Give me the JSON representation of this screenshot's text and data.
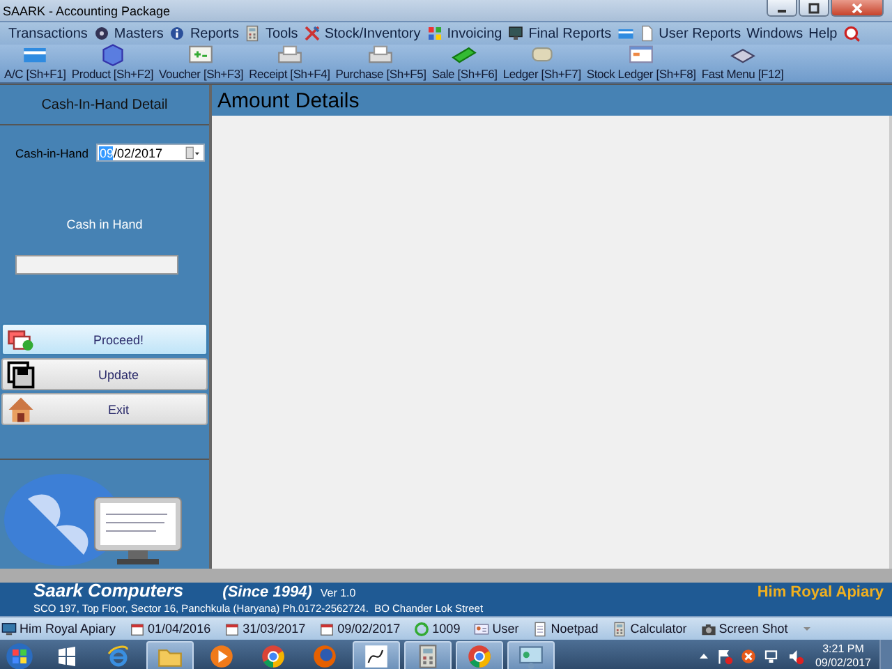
{
  "window": {
    "title": "SAARK - Accounting Package"
  },
  "menu": [
    {
      "label": "Transactions"
    },
    {
      "label": "Masters"
    },
    {
      "label": "Reports"
    },
    {
      "label": "Tools"
    },
    {
      "label": "Stock/Inventory"
    },
    {
      "label": "Invoicing"
    },
    {
      "label": "Final Reports"
    },
    {
      "label": "User Reports"
    },
    {
      "label": "Windows"
    },
    {
      "label": "Help"
    }
  ],
  "toolbar": [
    {
      "label": "A/C [Sh+F1]"
    },
    {
      "label": "Product [Sh+F2]"
    },
    {
      "label": "Voucher [Sh+F3]"
    },
    {
      "label": "Receipt [Sh+F4]"
    },
    {
      "label": "Purchase [Sh+F5]"
    },
    {
      "label": "Sale [Sh+F6]"
    },
    {
      "label": "Ledger [Sh+F7]"
    },
    {
      "label": "Stock Ledger [Sh+F8]"
    },
    {
      "label": "Fast Menu [F12]"
    }
  ],
  "sidebar": {
    "title": "Cash-In-Hand Detail",
    "date_label": "Cash-in-Hand",
    "date_selected_part": "09",
    "date_rest": "/02/2017",
    "amount_label": "Cash in Hand",
    "buttons": [
      {
        "label": "Proceed!",
        "selected": true
      },
      {
        "label": "Update",
        "selected": false
      },
      {
        "label": "Exit",
        "selected": false
      }
    ]
  },
  "content": {
    "title": "Amount Details"
  },
  "company": {
    "name": "Saark Computers",
    "since": "(Since 1994)",
    "version": "Ver 1.0",
    "address": "SCO 197, Top Floor, Sector 16, Panchkula (Haryana) Ph.0172-2562724.  BO Chander Lok Street",
    "client": "Him Royal Apiary"
  },
  "status_bar": [
    {
      "text": "Him Royal Apiary"
    },
    {
      "text": "01/04/2016"
    },
    {
      "text": "31/03/2017"
    },
    {
      "text": "09/02/2017"
    },
    {
      "text": "1009"
    },
    {
      "text": "User"
    },
    {
      "text": "Noetpad"
    },
    {
      "text": "Calculator"
    },
    {
      "text": "Screen Shot"
    }
  ],
  "taskbar": {
    "apps": [
      {
        "open": true
      },
      {
        "open": false
      },
      {
        "open": false
      },
      {
        "open": false
      },
      {
        "open": true
      },
      {
        "open": true
      },
      {
        "open": true
      },
      {
        "open": true
      }
    ],
    "time": "3:21 PM",
    "date": "09/02/2017"
  }
}
